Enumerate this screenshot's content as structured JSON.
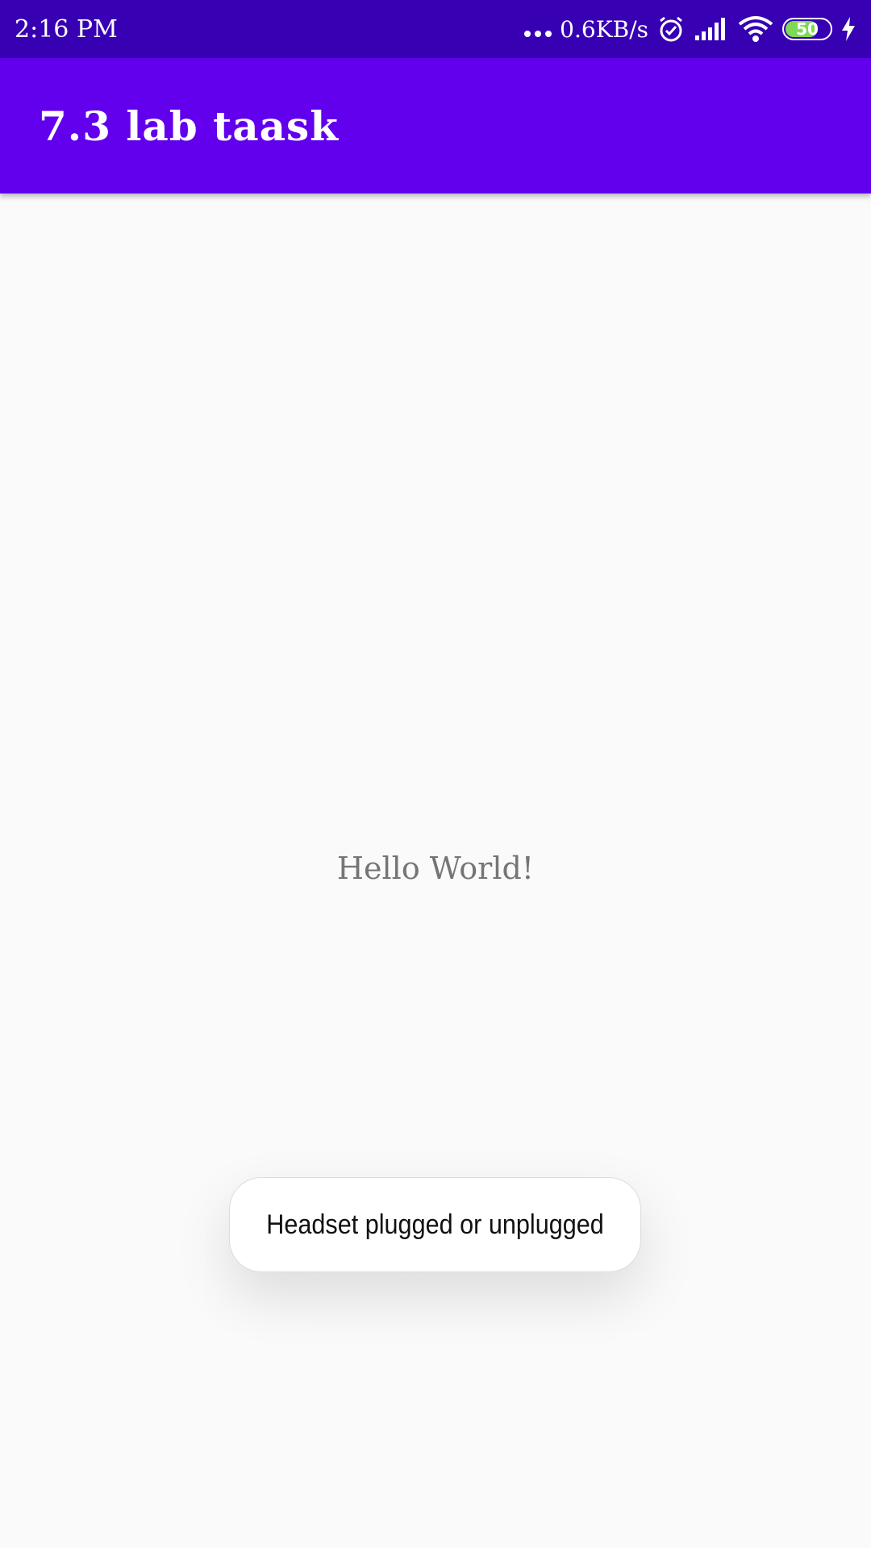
{
  "status_bar": {
    "time": "2:16 PM",
    "network_speed": "0.6KB/s",
    "battery_level": "50",
    "icons": [
      "more-dots-icon",
      "alarm-icon",
      "signal-icon",
      "wifi-icon",
      "battery-icon",
      "charging-icon"
    ],
    "background_color": "#3700b3"
  },
  "app_bar": {
    "title": "7.3 lab taask",
    "background_color": "#6200ee"
  },
  "main": {
    "message": "Hello World!"
  },
  "toast": {
    "message": "Headset plugged or unplugged"
  }
}
